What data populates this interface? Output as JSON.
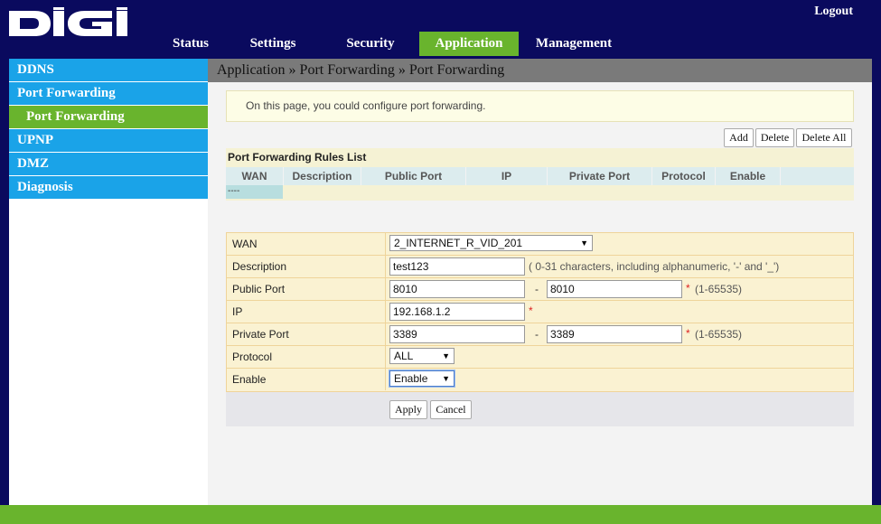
{
  "header": {
    "logo_text": "DIGI",
    "logout": "Logout",
    "nav": [
      "Status",
      "Settings",
      "Security",
      "Application",
      "Management"
    ],
    "active_nav": "Application"
  },
  "sidebar": {
    "items": [
      {
        "label": "DDNS"
      },
      {
        "label": "Port Forwarding"
      },
      {
        "label": "Port Forwarding",
        "sub": true,
        "active": true
      },
      {
        "label": "UPNP"
      },
      {
        "label": "DMZ"
      },
      {
        "label": "Diagnosis"
      }
    ]
  },
  "breadcrumb": "Application » Port Forwarding » Port Forwarding",
  "info": "On this page, you could configure port forwarding.",
  "list_buttons": {
    "add": "Add",
    "delete": "Delete",
    "delete_all": "Delete All"
  },
  "rules": {
    "title": "Port Forwarding Rules List",
    "columns": [
      "WAN",
      "Description",
      "Public Port",
      "IP",
      "Private Port",
      "Protocol",
      "Enable"
    ],
    "empty_row": "----"
  },
  "form": {
    "wan": {
      "label": "WAN",
      "value": "2_INTERNET_R_VID_201"
    },
    "description": {
      "label": "Description",
      "value": "test123",
      "hint": "( 0-31 characters, including alphanumeric, '-' and '_')"
    },
    "public_port": {
      "label": "Public Port",
      "start": "8010",
      "end": "8010",
      "dash": "-",
      "required": "*",
      "hint": "(1-65535)"
    },
    "ip": {
      "label": "IP",
      "value": "192.168.1.2",
      "required": "*"
    },
    "private_port": {
      "label": "Private Port",
      "start": "3389",
      "end": "3389",
      "dash": "-",
      "required": "*",
      "hint": "(1-65535)"
    },
    "protocol": {
      "label": "Protocol",
      "value": "ALL"
    },
    "enable": {
      "label": "Enable",
      "value": "Enable"
    }
  },
  "actions": {
    "apply": "Apply",
    "cancel": "Cancel"
  },
  "colors": {
    "navy": "#0a0a5e",
    "green": "#69b42d",
    "blue": "#1aa3e8"
  }
}
